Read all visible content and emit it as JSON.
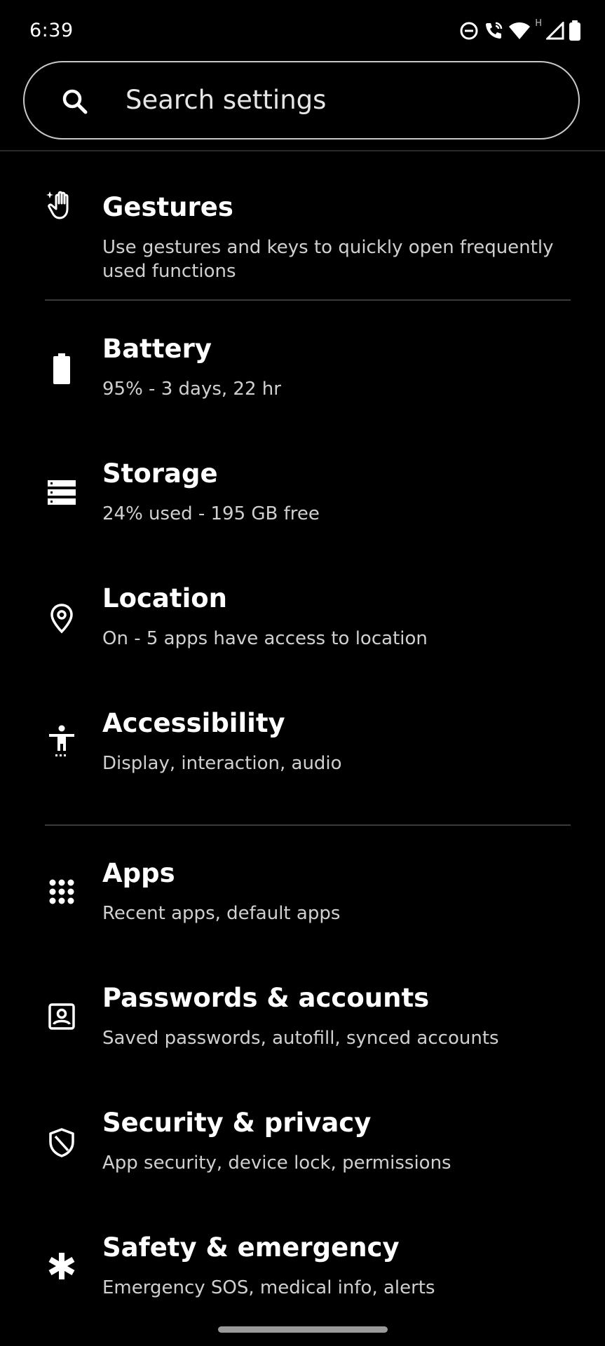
{
  "status_bar": {
    "time": "6:39",
    "network_label": "H",
    "icons": [
      "do-not-disturb-icon",
      "wifi-calling-icon",
      "wifi-icon",
      "cellular-signal-icon",
      "battery-icon"
    ]
  },
  "search": {
    "placeholder": "Search settings"
  },
  "settings": {
    "gestures": {
      "title": "Gestures",
      "subtitle": "Use gestures and keys to quickly open frequently used functions",
      "icon": "gesture-hand-icon"
    },
    "battery": {
      "title": "Battery",
      "subtitle": "95% - 3 days, 22 hr",
      "icon": "battery-icon"
    },
    "storage": {
      "title": "Storage",
      "subtitle": "24% used - 195 GB free",
      "icon": "storage-icon"
    },
    "location": {
      "title": "Location",
      "subtitle": "On - 5 apps have access to location",
      "icon": "location-pin-icon"
    },
    "accessibility": {
      "title": "Accessibility",
      "subtitle": "Display, interaction, audio",
      "icon": "accessibility-icon"
    },
    "apps": {
      "title": "Apps",
      "subtitle": "Recent apps, default apps",
      "icon": "apps-grid-icon"
    },
    "passwords": {
      "title": "Passwords & accounts",
      "subtitle": "Saved passwords, autofill, synced accounts",
      "icon": "account-box-icon"
    },
    "security": {
      "title": "Security & privacy",
      "subtitle": "App security, device lock, permissions",
      "icon": "shield-icon"
    },
    "safety": {
      "title": "Safety & emergency",
      "subtitle": "Emergency SOS, medical info, alerts",
      "icon": "emergency-asterisk-icon"
    }
  },
  "colors": {
    "background": "#000000",
    "text_primary": "#ffffff",
    "text_secondary": "#d0d0d0",
    "divider": "#3a3a3a"
  }
}
